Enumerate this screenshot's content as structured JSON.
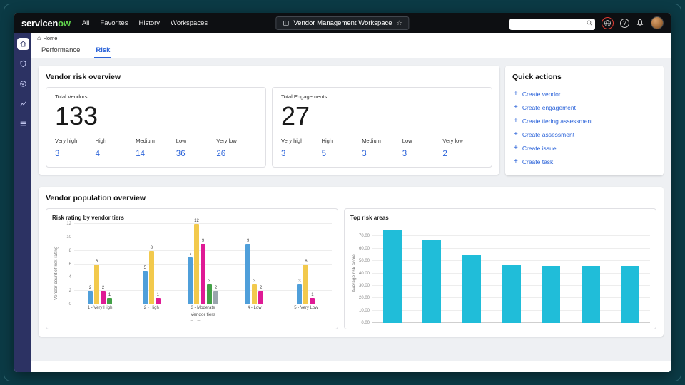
{
  "header": {
    "logo_service": "servicen",
    "logo_now": "ow",
    "nav": [
      "All",
      "Favorites",
      "History",
      "Workspaces"
    ],
    "workspace_label": "Vendor Management Workspace",
    "search_value": ""
  },
  "icons": {
    "plus": "+",
    "star": "☆",
    "home": "⌂",
    "help": "?"
  },
  "breadcrumb": {
    "home_label": "Home"
  },
  "tabs": {
    "performance": "Performance",
    "risk": "Risk"
  },
  "risk_overview": {
    "title": "Vendor risk overview",
    "vendors": {
      "title": "Total Vendors",
      "total": "133",
      "breakdown": [
        {
          "label": "Very high",
          "value": "3"
        },
        {
          "label": "High",
          "value": "4"
        },
        {
          "label": "Medium",
          "value": "14"
        },
        {
          "label": "Low",
          "value": "36"
        },
        {
          "label": "Very low",
          "value": "26"
        }
      ]
    },
    "engagements": {
      "title": "Total Engagements",
      "total": "27",
      "breakdown": [
        {
          "label": "Very high",
          "value": "3"
        },
        {
          "label": "High",
          "value": "5"
        },
        {
          "label": "Medium",
          "value": "3"
        },
        {
          "label": "Low",
          "value": "3"
        },
        {
          "label": "Very low",
          "value": "2"
        }
      ]
    }
  },
  "quick_actions": {
    "title": "Quick actions",
    "items": [
      "Create vendor",
      "Create engagement",
      "Create tiering assessment",
      "Create assessment",
      "Create issue",
      "Create task"
    ]
  },
  "population": {
    "title": "Vendor population overview",
    "pager": "– –"
  },
  "colors": {
    "accent_blue": "#2b63d9",
    "logo_green": "#62d84e",
    "sidebar": "#2c3263"
  },
  "chart_data": [
    {
      "type": "bar",
      "title": "Risk rating by vendor tiers",
      "xlabel": "Vendor tiers",
      "ylabel": "Vendor count of risk rating",
      "ylim": [
        0,
        12
      ],
      "yticks": [
        "0",
        "2",
        "4",
        "6",
        "8",
        "10",
        "12"
      ],
      "grid": true,
      "categories": [
        "1 - Very High",
        "2 - High",
        "3 - Moderate",
        "4 - Low",
        "5 - Very Low"
      ],
      "series": [
        {
          "name": "blue",
          "color": "#4f9fda",
          "values": [
            2,
            5,
            7,
            9,
            3
          ]
        },
        {
          "name": "yellow",
          "color": "#f2c94c",
          "values": [
            6,
            8,
            12,
            3,
            6
          ]
        },
        {
          "name": "magenta",
          "color": "#df1a95",
          "values": [
            2,
            1,
            9,
            2,
            1
          ]
        },
        {
          "name": "green",
          "color": "#43a047",
          "values": [
            1,
            null,
            3,
            null,
            null
          ]
        },
        {
          "name": "gray",
          "color": "#9aa5ad",
          "values": [
            null,
            null,
            2,
            null,
            null
          ]
        }
      ]
    },
    {
      "type": "bar",
      "title": "Top risk areas",
      "ylabel": "Average risk score",
      "ylim": [
        0,
        80
      ],
      "yticks": [
        "0.00",
        "10.00",
        "20.00",
        "30.00",
        "40.00",
        "50.00",
        "60.00",
        "70.00"
      ],
      "grid": true,
      "bar_color": "#20bdd9",
      "values": [
        75,
        67,
        55,
        47,
        46,
        46,
        46
      ]
    }
  ]
}
